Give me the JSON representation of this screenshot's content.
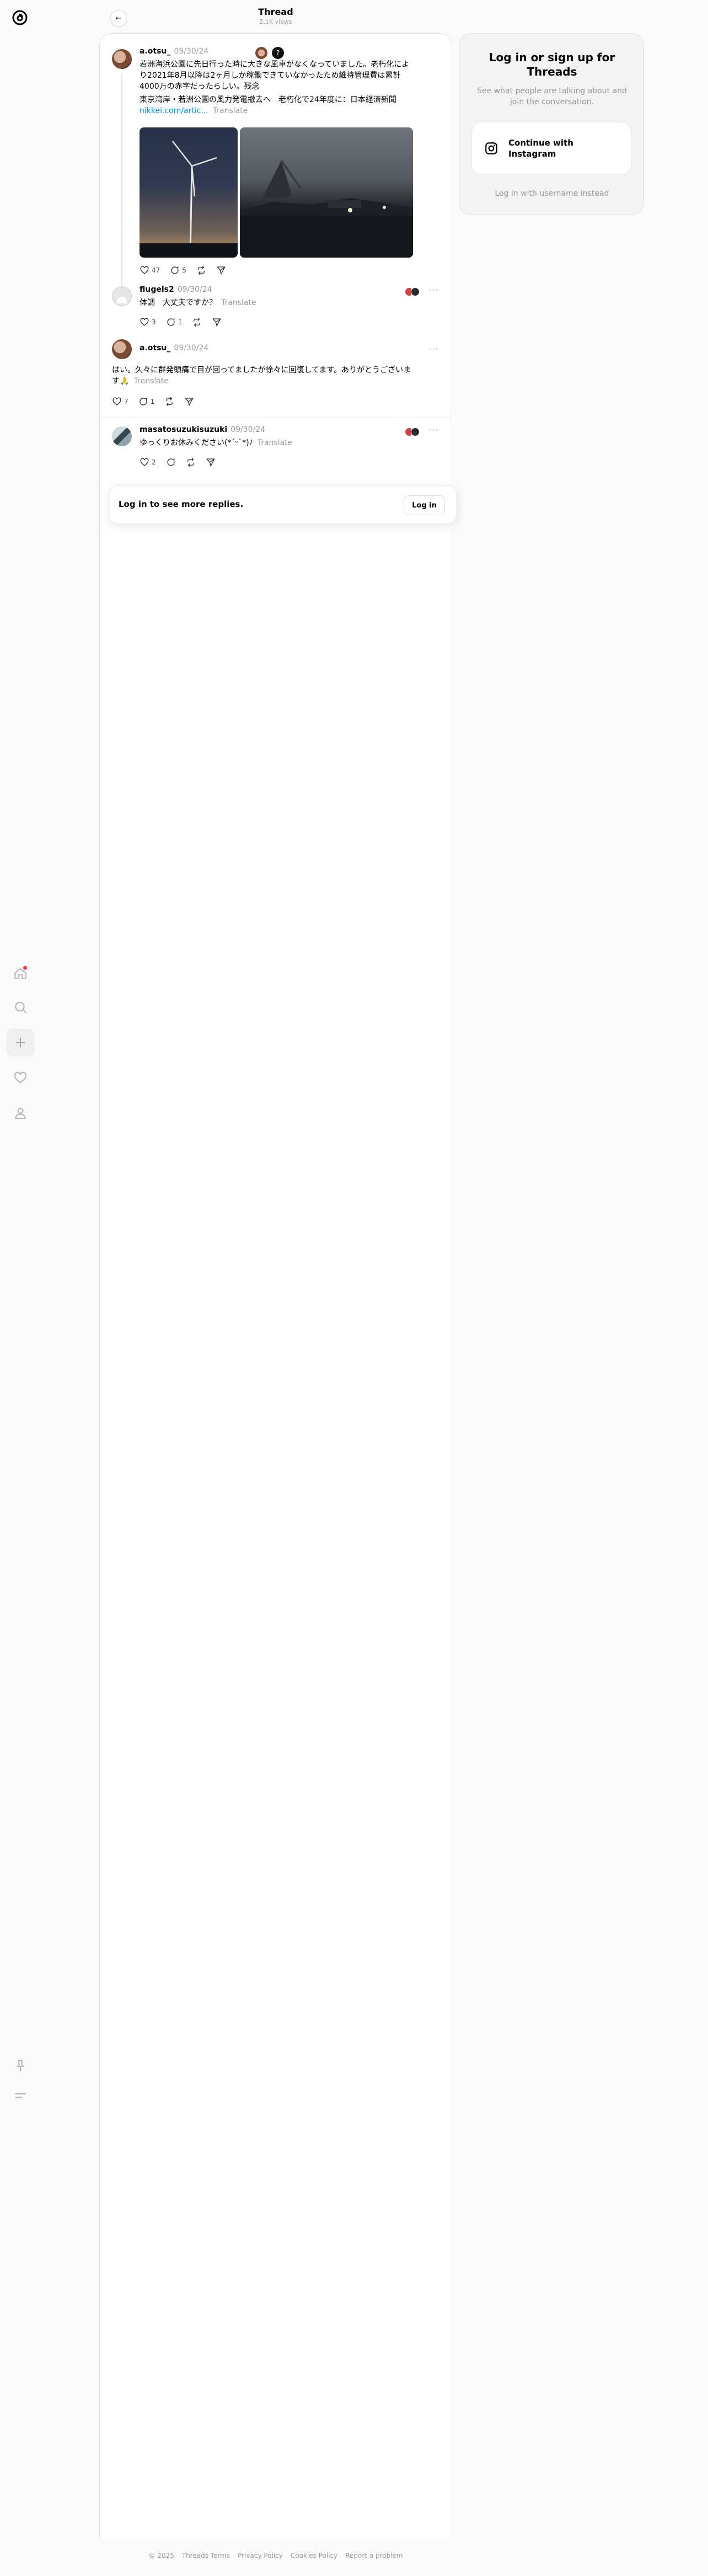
{
  "header": {
    "title": "Thread",
    "views": "2.1K views"
  },
  "posts": [
    {
      "username": "a.otsu_",
      "date": "09/30/24",
      "text_lines": [
        "若洲海浜公園に先日行った時に大きな風車がなくなっていました。老朽化によ",
        "り2021年8月以降は2ヶ月しか稼働できていなかったため維持管理費は累計",
        "4000万の赤字だったらしい。残念"
      ],
      "link_title": "東京湾岸・若洲公園の風力発電撤去へ　老朽化で24年度に：日本経済新聞",
      "link_url": "nikkei.com/artic...",
      "translate": "Translate",
      "likes": "47",
      "replies": "5"
    },
    {
      "username": "flugels2",
      "date": "09/30/24",
      "text": "体調　大丈夫ですか？",
      "translate": "Translate",
      "likes": "3",
      "replies": "1"
    },
    {
      "username": "a.otsu_",
      "date": "09/30/24",
      "text_lines": [
        "はい。久々に群発頭痛で目が回ってましたが徐々に回復してます。ありがとうございま",
        "す🙏"
      ],
      "translate": "Translate",
      "likes": "7",
      "replies": "1"
    },
    {
      "username": "masatosuzukisuzuki",
      "date": "09/30/24",
      "text": "ゆっくりお休みください(*ˊᵕˋ*)ﾉ",
      "translate": "Translate",
      "likes": "2",
      "replies": ""
    }
  ],
  "login_prompt": {
    "text": "Log in to see more replies.",
    "button": "Log in"
  },
  "side_card": {
    "title": "Log in or sign up for Threads",
    "subtitle": "See what people are talking about and join the conversation.",
    "instagram_button": "Continue with Instagram",
    "alt_login": "Log in with username instead"
  },
  "footer": {
    "copyright": "© 2025",
    "links": [
      "Threads Terms",
      "Privacy Policy",
      "Cookies Policy",
      "Report a problem"
    ]
  },
  "icons": {
    "logo": "threads-logo",
    "nav": [
      "home-icon",
      "search-icon",
      "create-icon",
      "heart-icon",
      "profile-icon"
    ],
    "bottom": [
      "pin-icon",
      "menu-icon"
    ]
  },
  "colors": {
    "notification_dot": "#ff3040",
    "link": "#0095f6"
  }
}
